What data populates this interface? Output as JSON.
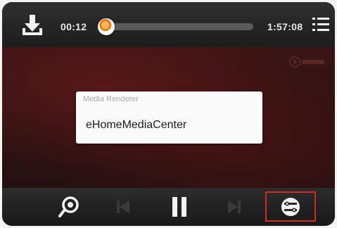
{
  "player": {
    "elapsed_time": "00:12",
    "total_time": "1:57:08",
    "progress_fraction": 0.0,
    "accent_color": "#e98a22"
  },
  "dialog": {
    "title": "Media Renderer",
    "device_name": "eHomeMediaCenter"
  },
  "icons": {
    "download": "download-icon",
    "playlist": "playlist-icon",
    "push_play": "push-play-icon",
    "previous": "previous-track-icon",
    "pause": "pause-icon",
    "next": "next-track-icon",
    "renderer": "media-renderer-icon"
  },
  "highlight_color": "#d42a22"
}
